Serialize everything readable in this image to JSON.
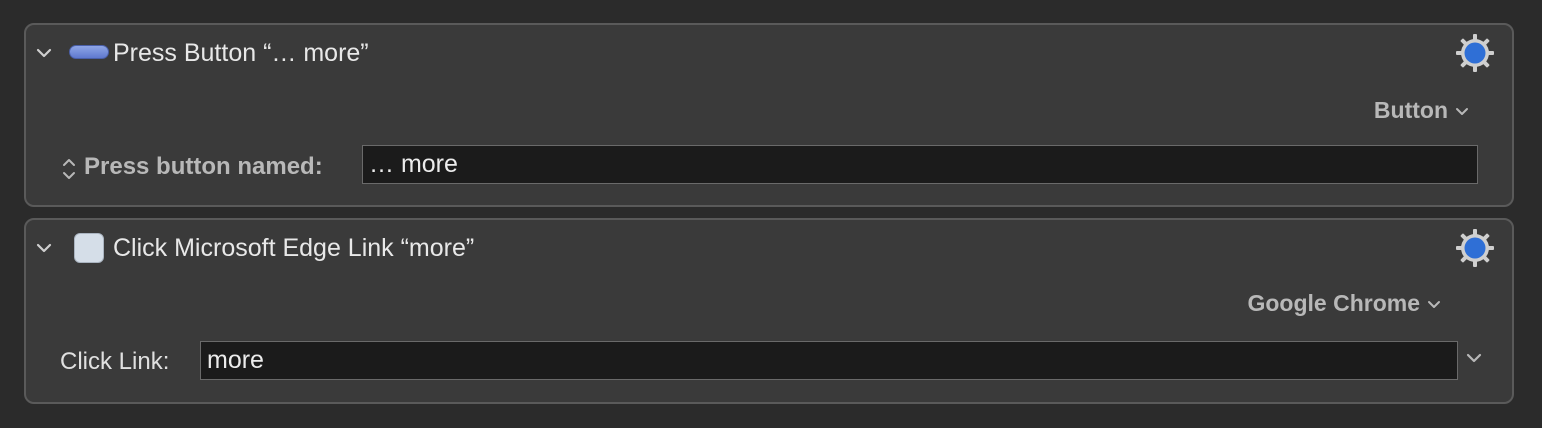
{
  "actions": [
    {
      "title": "Press Button “… more”",
      "popup": "Button",
      "field_label": "Press button named:",
      "field_value": "… more",
      "icon": "button-icon"
    },
    {
      "title": "Click Microsoft Edge Link “more”",
      "popup": "Google Chrome",
      "field_label": "Click Link:",
      "field_value": "more",
      "icon": "link-icon"
    }
  ],
  "colors": {
    "background": "#2b2b2b",
    "panel": "#3a3a3a",
    "field": "#1b1b1b",
    "gear_accent": "#2f6fd6"
  }
}
